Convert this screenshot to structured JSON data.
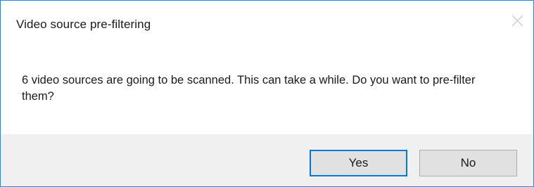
{
  "dialog": {
    "title": "Video source pre-filtering",
    "message": "6 video sources are going to be scanned. This can take a while. Do you want to pre-filter them?",
    "close_icon": "close-icon",
    "buttons": {
      "yes_label": "Yes",
      "no_label": "No"
    },
    "colors": {
      "window_border": "#1e88e5",
      "focus_border": "#0078d7",
      "footer_background": "#f0f0f0",
      "button_background": "#e1e1e1"
    }
  }
}
